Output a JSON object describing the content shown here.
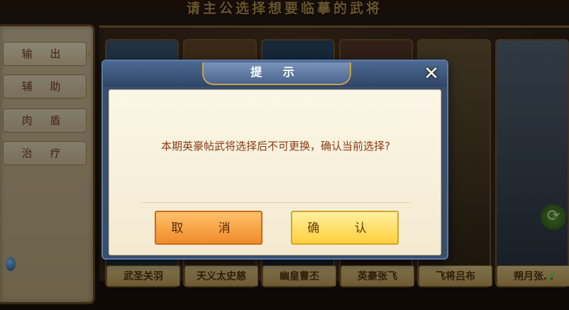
{
  "screen": {
    "title": "请主公选择想要临摹的武将"
  },
  "sidebar": {
    "items": [
      {
        "label": "输 出",
        "active": true
      },
      {
        "label": "辅 助",
        "active": false
      },
      {
        "label": "肉 盾",
        "active": false
      },
      {
        "label": "治 疗",
        "active": false
      }
    ]
  },
  "heroes": [
    {
      "name": "武圣关羽"
    },
    {
      "name": "天义太史慈"
    },
    {
      "name": "幽皇曹丕"
    },
    {
      "name": "英豪张飞"
    },
    {
      "name": "飞将吕布"
    },
    {
      "name": "朔月张…"
    }
  ],
  "dialog": {
    "title": "提 示",
    "message": "本期英豪帖武将选择后不可更换，确认当前选择?",
    "cancel_label": "取 消",
    "confirm_label": "确 认",
    "close_glyph": "✕"
  },
  "icons": {
    "refresh": "refresh-icon",
    "check": "check-icon",
    "arrow": "chevron-right-icon"
  },
  "colors": {
    "dialog_frame": "#3a4e6e",
    "message_text": "#8a3a12",
    "cancel_button": "#f08a2a",
    "confirm_button": "#ffd03a"
  }
}
